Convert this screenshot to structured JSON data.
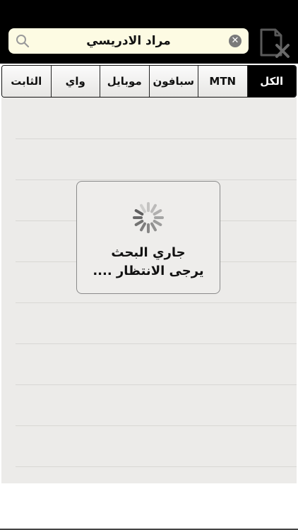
{
  "search": {
    "value": "مراد الادريسي"
  },
  "tabs": [
    {
      "label": "الكل",
      "active": true
    },
    {
      "label": "MTN",
      "active": false
    },
    {
      "label": "سبافون",
      "active": false
    },
    {
      "label": "موبايل",
      "active": false
    },
    {
      "label": "واي",
      "active": false
    },
    {
      "label": "الثابت",
      "active": false
    }
  ],
  "loading": {
    "line1": "جاري البحث",
    "line2": "يرجى الانتظار ...."
  },
  "icons": {
    "search": "search-icon",
    "clear": "clear-icon",
    "document": "document-close-icon",
    "spinner": "spinner-icon"
  },
  "colors": {
    "bar": "#000000",
    "field": "#fdfbe3",
    "list": "#ecebe9",
    "activeTab": "#000000"
  }
}
